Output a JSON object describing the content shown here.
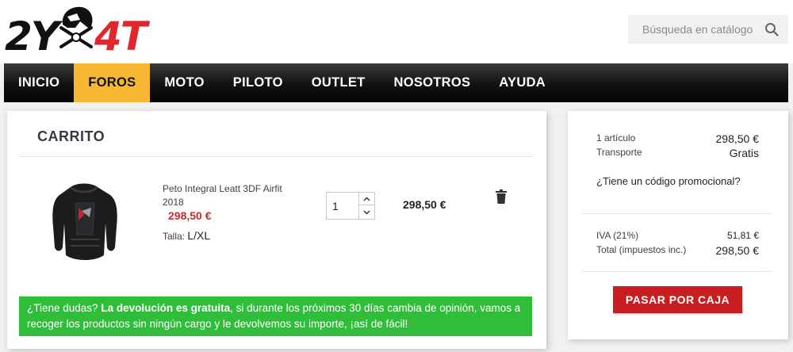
{
  "brand": {
    "logo_left": "2Y",
    "logo_right": "4T"
  },
  "search": {
    "placeholder": "Búsqueda en catálogo",
    "icon": "search-icon"
  },
  "nav": {
    "items": [
      {
        "label": "INICIO"
      },
      {
        "label": "FOROS",
        "active": true
      },
      {
        "label": "MOTO"
      },
      {
        "label": "PILOTO"
      },
      {
        "label": "OUTLET"
      },
      {
        "label": "NOSOTROS"
      },
      {
        "label": "AYUDA"
      }
    ]
  },
  "cart": {
    "title": "CARRITO",
    "item": {
      "name": "Peto Integral Leatt 3DF Airfit 2018",
      "price": "298,50 €",
      "attribute_label": "Talla:",
      "attribute_value": "L/XL",
      "quantity": "1",
      "line_total": "298,50 €"
    },
    "notice": {
      "lead": "¿Tiene dudas?",
      "bold": "La devolución es gratuita",
      "rest": ", si durante los próximos 30 días cambia de opinión, vamos a recoger los productos sin ningún cargo y le devolvemos su importe, ¡así de fácil!"
    }
  },
  "summary": {
    "items_label": "1 artículo",
    "items_value": "298,50 €",
    "shipping_label": "Transporte",
    "shipping_value": "Gratis",
    "promo_link": "¿Tiene un código promocional?",
    "tax_label": "IVA (21%)",
    "tax_value": "51,81 €",
    "total_label": "Total (impuestos inc.)",
    "total_value": "298,50 €",
    "checkout_label": "PASAR POR CAJA"
  },
  "colors": {
    "nav_active": "#f7b733",
    "price_red": "#c22e32",
    "notice_green": "#2fbd3a",
    "checkout_red": "#c81e20"
  }
}
